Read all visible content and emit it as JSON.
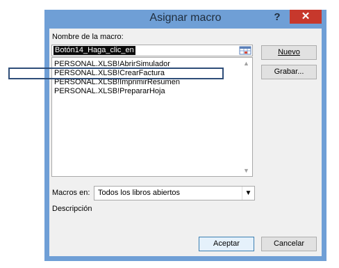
{
  "dialog": {
    "title": "Asignar macro",
    "help": "?",
    "close": "✕"
  },
  "macro_name": {
    "label": "Nombre de la macro:",
    "value": "Botón14_Haga_clic_en"
  },
  "macro_list": [
    "PERSONAL.XLSB!AbrirSimulador",
    "PERSONAL.XLSB!CrearFactura",
    "PERSONAL.XLSB!ImprimirResumen",
    "PERSONAL.XLSB!PrepararHoja"
  ],
  "buttons": {
    "new_label": "Nuevo",
    "record_label": "Grabar...",
    "accept_label": "Aceptar",
    "cancel_label": "Cancelar"
  },
  "macros_in": {
    "label": "Macros en:",
    "value": "Todos los libros abiertos"
  },
  "description": {
    "label": "Descripción"
  },
  "colors": {
    "window_frame": "#6f9fd6",
    "close_button": "#c7382c",
    "highlight_box": "#2e4d78"
  }
}
